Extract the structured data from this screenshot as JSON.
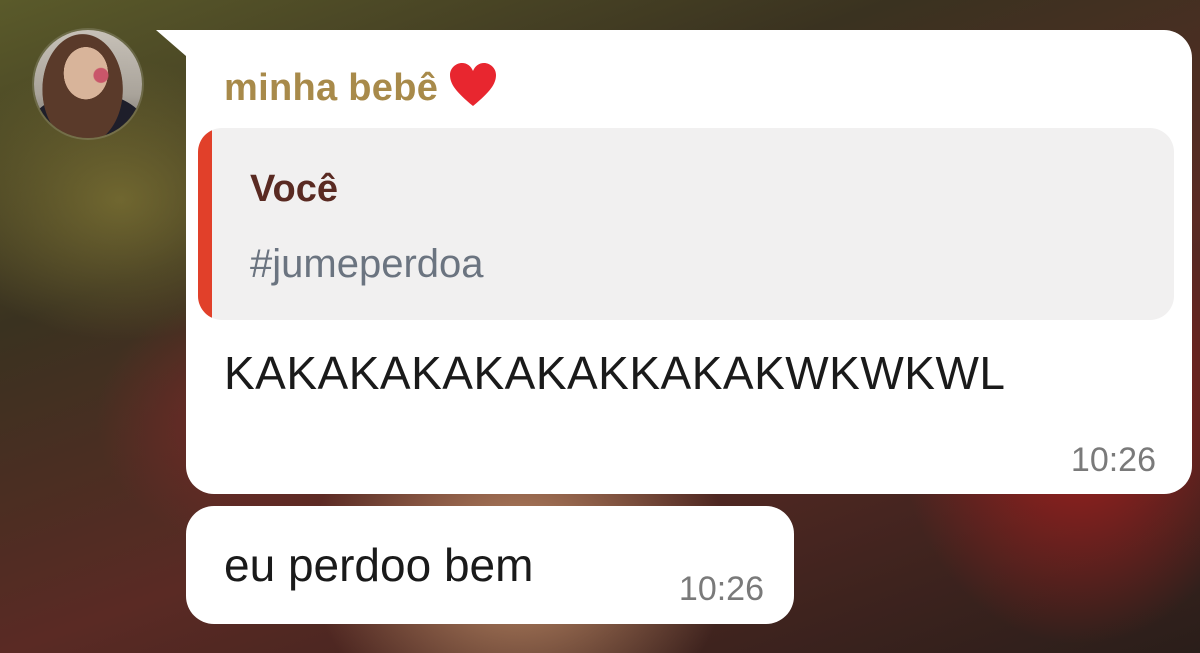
{
  "chat": {
    "sender": {
      "name": "minha bebê",
      "name_icon": "heart-icon",
      "avatar": "contact-avatar"
    },
    "messages": [
      {
        "reply_to": {
          "author": "Você",
          "text": "#jumeperdoa",
          "accent_color": "#e1402a"
        },
        "text": "KAKAKAKAKAKAKKAKAKWKWKWL",
        "time": "10:26"
      },
      {
        "text": "eu perdoo bem",
        "time": "10:26"
      }
    ]
  },
  "colors": {
    "sender_name": "#a88a4a",
    "quote_author": "#5a2a22",
    "quote_text": "#6b7480",
    "bubble": "#ffffff",
    "heart": "#e8262f"
  }
}
